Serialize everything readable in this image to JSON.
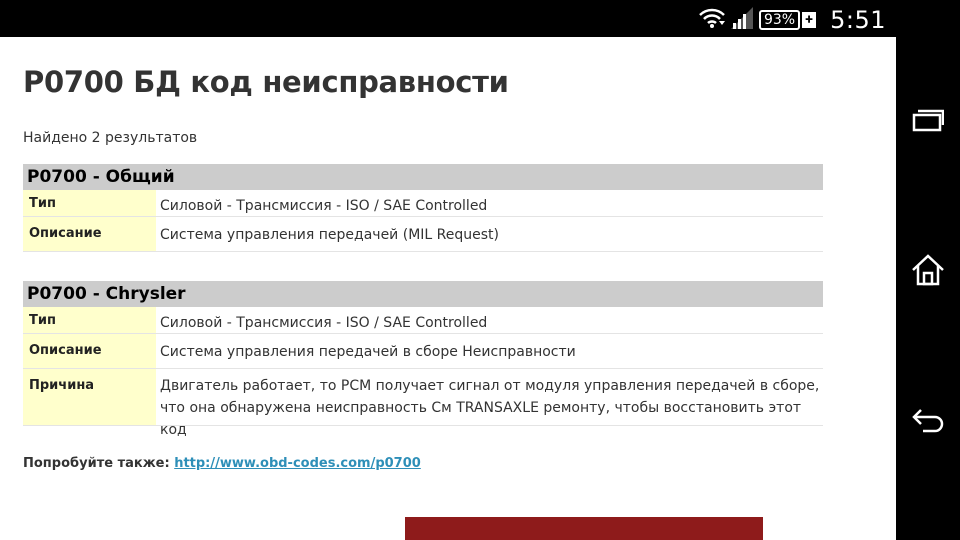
{
  "status_bar": {
    "battery_percent": "93%",
    "time": "5:51"
  },
  "page": {
    "title": "P0700 БД код неисправности",
    "results_text": "Найдено 2 результатов",
    "codes": [
      {
        "header": "P0700 - Общий",
        "rows": [
          {
            "label": "Тип",
            "value": "Силовой - Трансмиссия - ISO / SAE Controlled"
          },
          {
            "label": "Описание",
            "value": "Система управления передачей (MIL Request)"
          }
        ]
      },
      {
        "header": "P0700 - Chrysler",
        "rows": [
          {
            "label": "Тип",
            "value": "Силовой - Трансмиссия - ISO / SAE Controlled"
          },
          {
            "label": "Описание",
            "value": "Система управления передачей в сборе Неисправности"
          },
          {
            "label": "Причина",
            "value": "Двигатель работает, то PCM получает сигнал от модуля управления передачей в сборе, что она обнаружена неисправность См TRANSAXLE ремонту, чтобы восстановить этот код"
          }
        ]
      }
    ],
    "also_label": "Попробуйте также:",
    "also_link": "http://www.obd-codes.com/p0700"
  },
  "colors": {
    "header_bg": "#cccccc",
    "label_bg": "#ffffcc",
    "link": "#2e8fb8",
    "ad": "#8e1b1b"
  }
}
